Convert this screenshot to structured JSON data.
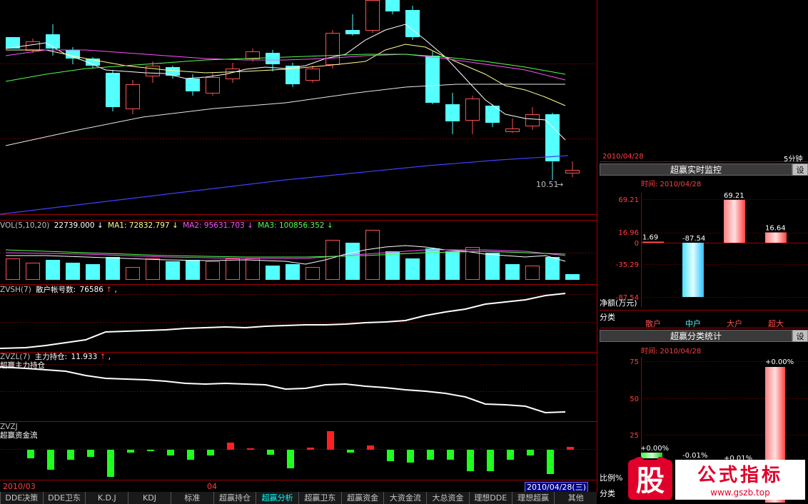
{
  "main_chart": {
    "price_label": "10.51",
    "vol_legend": {
      "name": "VOL(5,10,20)",
      "value": "22739.000",
      "value_arrow": "↓",
      "ma1": "MA1: 72832.797",
      "ma1_arrow": "↓",
      "ma2": "MA2: 95631.703",
      "ma2_arrow": "↓",
      "ma3": "MA3: 100856.352",
      "ma3_arrow": "↓"
    },
    "zvsh_legend": {
      "name": "ZVSH(7)",
      "label": "散户帐号数:",
      "value": "76586",
      "arrow": "↑"
    },
    "zvzl_legend": {
      "name": "ZVZL(7)",
      "label": "主力持仓:",
      "value": "11.933",
      "arrow": "↑",
      "sub": "超赢主力持仓"
    },
    "zvzj_legend": {
      "name": "ZVZJ",
      "sub": "超赢资金流"
    },
    "date_start": "2010/03",
    "date_mid": "04",
    "date_current": "2010/04/28(三)"
  },
  "tabs": [
    "DDE决策",
    "DDE卫东",
    "K.D.J",
    "KDJ",
    "标准",
    "超赢持仓",
    "超赢分析",
    "超赢卫东",
    "超赢资金",
    "大资金流",
    "大总资金",
    "理想DDE",
    "理想超赢",
    "其他"
  ],
  "active_tab": "超赢分析",
  "right_panel": {
    "header_date": "2010/04/28",
    "period": "5分钟",
    "monitor": {
      "title": "超赢实时监控",
      "settings_label": "设",
      "time_label": "时间: 2010/04/28",
      "axis": [
        "69.21",
        "16.96",
        "0",
        "-35.29",
        "-87.54"
      ],
      "ylabel": "净额(万元)",
      "category_label": "分类",
      "categories": [
        "散户",
        "中户",
        "大户",
        "超大"
      ],
      "values": [
        1.69,
        -87.54,
        69.21,
        16.64
      ],
      "value_labels": [
        "1.69",
        "-87.54",
        "69.21",
        "16.64"
      ]
    },
    "classify": {
      "title": "超赢分类统计",
      "settings_label": "设",
      "time_label": "时间: 2010/04/28",
      "axis": [
        "75",
        "50",
        "25"
      ],
      "ratio_label": "比例%",
      "category_label": "分类",
      "value_labels": [
        "+0.00%",
        "-0.01%",
        "+0.01%",
        "+0.00%"
      ]
    }
  },
  "watermark": {
    "logo_char": "股",
    "title": "公式指标",
    "url": "www.gszb.top"
  },
  "colors": {
    "up": "#ff5050",
    "down": "#54ffff",
    "grid": "#800000",
    "ma_white": "#ffffff",
    "ma_yellow": "#ffff80",
    "ma_purple": "#ff50ff",
    "ma_green": "#50ff50",
    "ma_blue": "#4040ff"
  }
}
